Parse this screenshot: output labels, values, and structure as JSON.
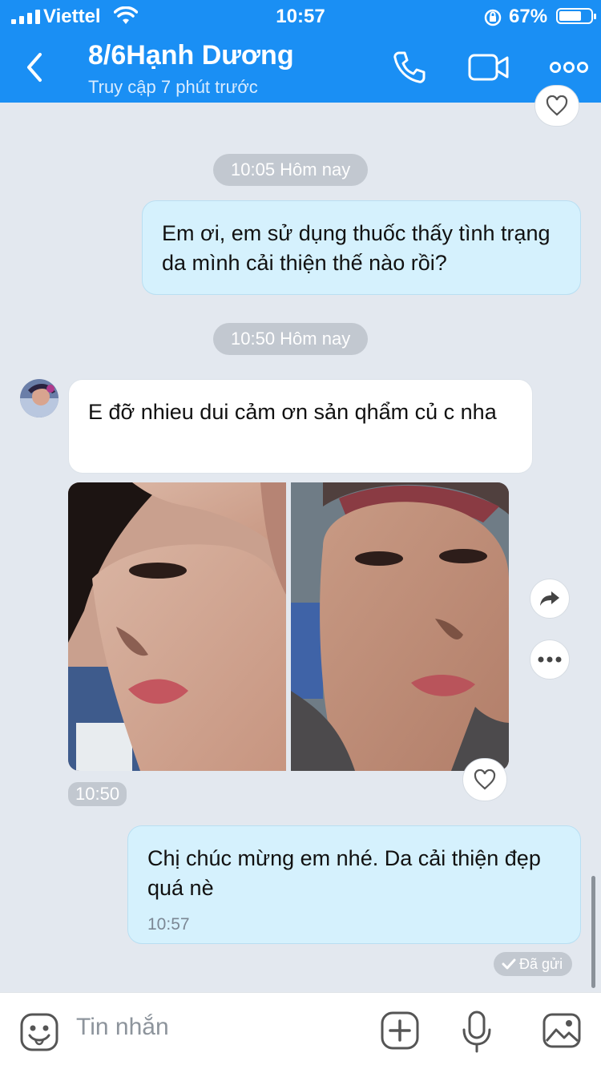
{
  "status_bar": {
    "carrier": "Viettel",
    "time": "10:57",
    "battery": "67%"
  },
  "header": {
    "name": "8/6Hạnh Dương",
    "last_seen": "Truy cập 7 phút trước"
  },
  "messages": {
    "time_sep_1": "10:05 Hôm nay",
    "out_1": "Em ơi, em sử dụng thuốc thấy tình trạng da mình cải thiện thế nào rồi?",
    "time_sep_2": "10:50 Hôm nay",
    "in_1": "E đỡ nhieu dui cảm ơn sản qhẩm củ c nha",
    "photo_time": "10:50",
    "out_2": "Chị chúc mừng em nhé. Da cải thiện đẹp quá nè",
    "out_2_time": "10:57",
    "sent_status": "Đã gửi"
  },
  "input": {
    "placeholder": "Tin nhắn"
  },
  "icons": {
    "back": "chevron-left-icon",
    "call": "phone-icon",
    "video": "video-camera-icon",
    "more": "more-icon",
    "heart": "heart-icon",
    "share": "share-icon",
    "emoji": "emoji-icon",
    "add": "plus-icon",
    "mic": "microphone-icon",
    "gallery": "image-icon"
  },
  "colors": {
    "header": "#1a8ff4",
    "outgoing_bubble": "#d5f1fd",
    "incoming_bubble": "#ffffff",
    "background": "#e3e8ef"
  }
}
